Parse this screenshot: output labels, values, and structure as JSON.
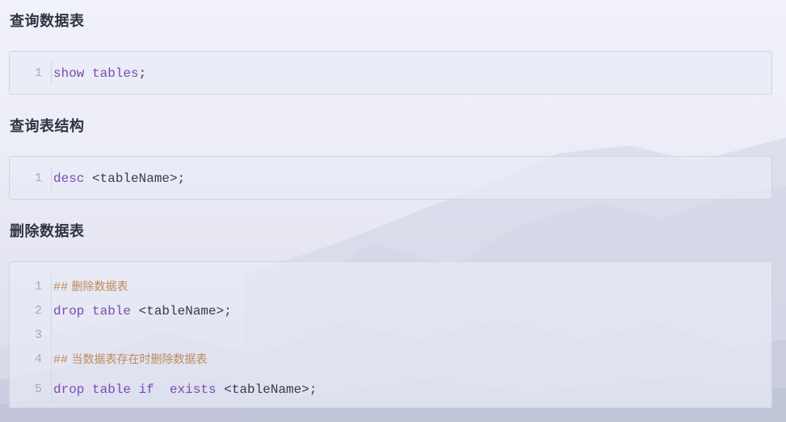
{
  "sections": [
    {
      "heading": "查询数据表",
      "lines": [
        {
          "num": "1",
          "keywords": "show tables",
          "rest": ";"
        }
      ]
    },
    {
      "heading": "查询表结构",
      "lines": [
        {
          "num": "1",
          "keywords": "desc",
          "rest": " <tableName>;"
        }
      ]
    },
    {
      "heading": "删除数据表",
      "lines": [
        {
          "num": "1",
          "comment_hash": "##",
          "comment_text": " 删除数据表"
        },
        {
          "num": "2",
          "keywords": "drop table",
          "rest": " <tableName>;"
        },
        {
          "num": "3",
          "keywords": "",
          "rest": ""
        },
        {
          "num": "4",
          "comment_hash": "##",
          "comment_text": " 当数据表存在时删除数据表"
        },
        {
          "num": "5",
          "keywords": "drop table if  exists",
          "rest": " <tableName>;"
        }
      ]
    }
  ],
  "colors": {
    "keyword": "#7b4bb0",
    "comment": "#c08a5a",
    "heading": "#2f3440",
    "line_number": "#a6aab8"
  }
}
